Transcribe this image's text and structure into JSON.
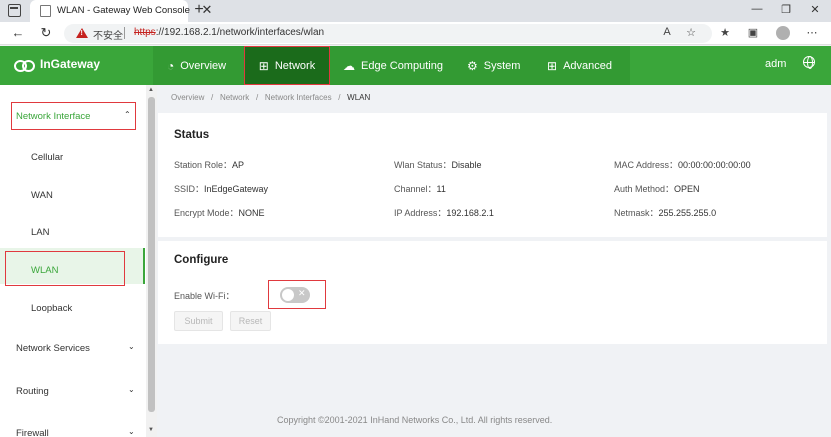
{
  "browser": {
    "tab_title": "WLAN - Gateway Web Console",
    "security_label": "不安全",
    "url_protocol": "https",
    "url_rest": "://192.168.2.1/network/interfaces/wlan",
    "close_glyph": "✕",
    "new_tab_glyph": "+"
  },
  "header": {
    "brand": "InGateway",
    "nav": [
      {
        "label": "Overview",
        "icon": "dashboard-icon"
      },
      {
        "label": "Network",
        "icon": "network-icon"
      },
      {
        "label": "Edge Computing",
        "icon": "cloud-icon"
      },
      {
        "label": "System",
        "icon": "gear-icon"
      },
      {
        "label": "Advanced",
        "icon": "grid-icon"
      }
    ],
    "user": "adm"
  },
  "sidebar": {
    "group_open": "Network Interface",
    "items": [
      "Cellular",
      "WAN",
      "LAN",
      "WLAN",
      "Loopback"
    ],
    "groups": [
      "Network Services",
      "Routing",
      "Firewall"
    ]
  },
  "breadcrumb": [
    "Overview",
    "Network",
    "Network Interfaces",
    "WLAN"
  ],
  "status": {
    "title": "Status",
    "station_role_label": "Station Role：",
    "station_role": "AP",
    "wlan_status_label": "Wlan Status：",
    "wlan_status": "Disable",
    "mac_label": "MAC Address：",
    "mac": "00:00:00:00:00:00",
    "ssid_label": "SSID：",
    "ssid": "InEdgeGateway",
    "channel_label": "Channel：",
    "channel": "11",
    "auth_label": "Auth Method：",
    "auth": "OPEN",
    "encrypt_label": "Encrypt Mode：",
    "encrypt": "NONE",
    "ip_label": "IP Address：",
    "ip": "192.168.2.1",
    "netmask_label": "Netmask：",
    "netmask": "255.255.255.0"
  },
  "configure": {
    "title": "Configure",
    "enable_wifi_label": "Enable Wi-Fi：",
    "enable_wifi": false,
    "submit": "Submit",
    "reset": "Reset"
  },
  "footer": "Copyright ©2001-2021 InHand Networks Co., Ltd. All rights reserved."
}
